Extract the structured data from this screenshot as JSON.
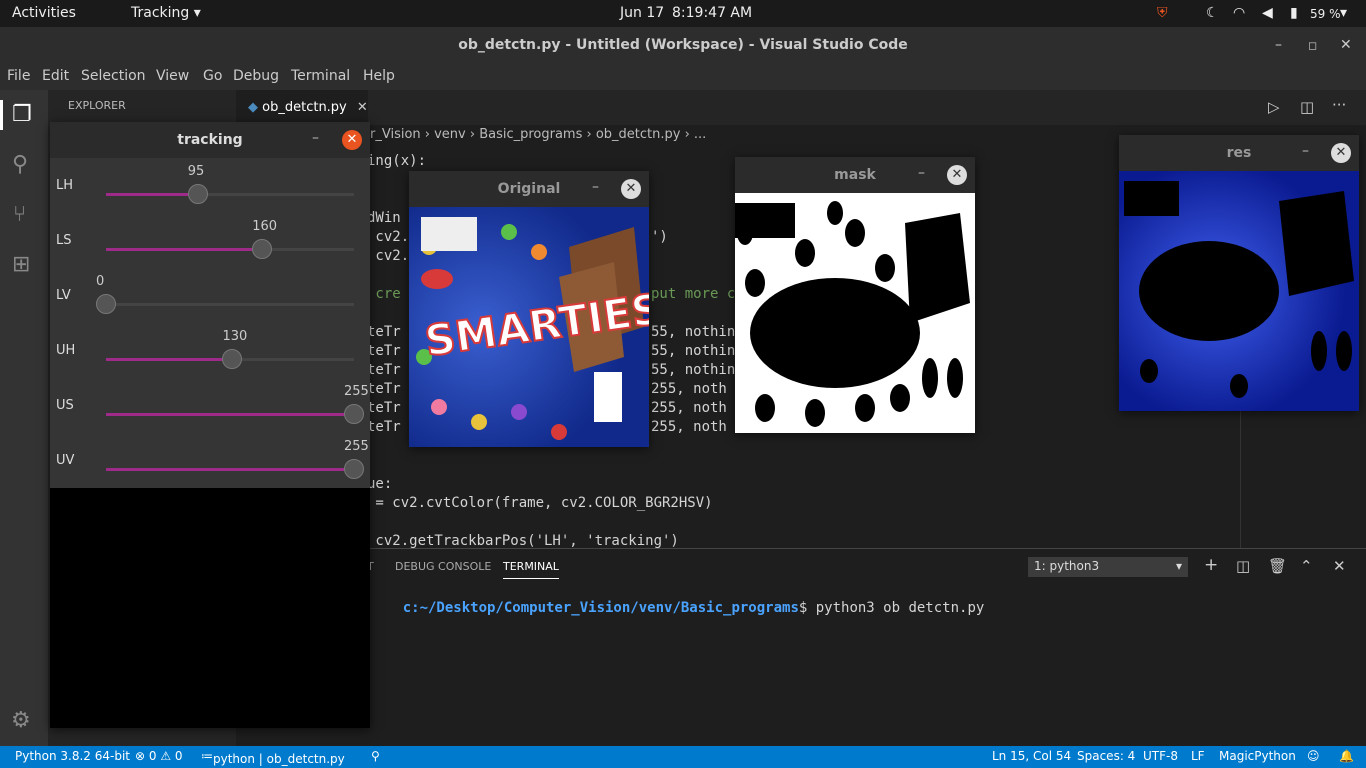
{
  "topbar": {
    "activities": "Activities",
    "app_menu": "Tracking",
    "date": "Jun 17",
    "time": "8:19:47 AM",
    "battery": "59 %"
  },
  "vscode": {
    "title": "ob_detctn.py - Untitled (Workspace) - Visual Studio Code",
    "menu": [
      "File",
      "Edit",
      "Selection",
      "View",
      "Go",
      "Debug",
      "Terminal",
      "Help"
    ],
    "explorer_label": "EXPLORER",
    "tab": "ob_detctn.py",
    "breadcrumb": "r_Vision › venv › Basic_programs › ob_detctn.py › ...",
    "code_lines": [
      "ing(x):",
      "",
      "",
      "dWin",
      " cv2.",
      " cv2.",
      "",
      " cre",
      "",
      "teTr",
      "teTr",
      "teTr",
      "teTr",
      "teTr",
      "teTr",
      "",
      "",
      "ue:",
      " = cv2.cvtColor(frame, cv2.COLOR_BGR2HSV)",
      "",
      " cv2.getTrackbarPos('LH', 'tracking')"
    ],
    "code_right_fragments": [
      "')",
      "put more c",
      "55, nothin",
      "55, nothin",
      "55, nothin",
      "255, noth",
      "255, noth",
      "255, noth"
    ],
    "panel_tabs": [
      "T",
      "DEBUG CONSOLE",
      "TERMINAL"
    ],
    "terminal_dropdown": "1: python3",
    "terminal_path": "c:~/Desktop/Computer_Vision/venv/Basic_programs",
    "terminal_cmd": "$ python3 ob detctn.py",
    "status": {
      "python": "Python 3.8.2 64-bit",
      "problems": "⊗ 0 ⚠ 0",
      "file": "python | ob_detctn.py",
      "position": "Ln 15, Col 54",
      "spaces": "Spaces: 4",
      "encoding": "UTF-8",
      "eol": "LF",
      "lang": "MagicPython"
    }
  },
  "tracking_window": {
    "title": "tracking",
    "sliders": [
      {
        "label": "LH",
        "value": "95",
        "fraction": 0.37
      },
      {
        "label": "LS",
        "value": "160",
        "fraction": 0.63
      },
      {
        "label": "LV",
        "value": "0",
        "fraction": 0.0
      },
      {
        "label": "UH",
        "value": "130",
        "fraction": 0.51
      },
      {
        "label": "US",
        "value": "255",
        "fraction": 1.0
      },
      {
        "label": "UV",
        "value": "255",
        "fraction": 1.0
      }
    ]
  },
  "original_window": {
    "title": "Original"
  },
  "mask_window": {
    "title": "mask"
  },
  "res_window": {
    "title": "res"
  },
  "colors": {
    "accent": "#007acc",
    "slider_fill": "#9e2a8a",
    "close_orange": "#e95420"
  }
}
